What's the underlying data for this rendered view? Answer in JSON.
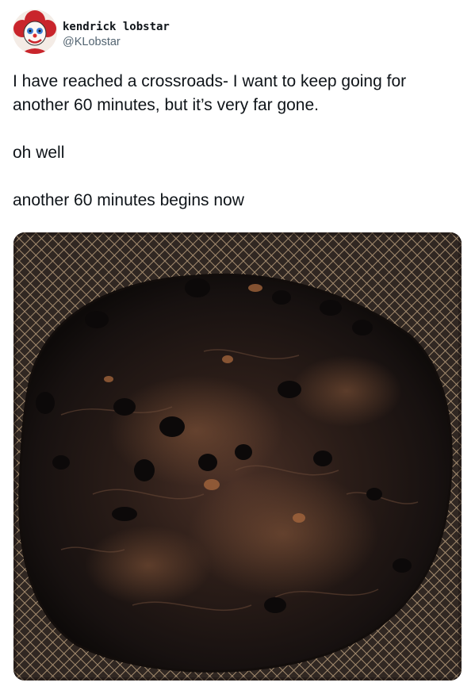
{
  "tweet": {
    "author": {
      "display_name": "kendrick lobstar",
      "handle": "@KLobstar",
      "avatar_icon": "clown-avatar-icon"
    },
    "text_lines": [
      "I have reached a crossroads- I want to keep going for another 60 minutes, but it’s very far gone.",
      "oh well",
      "another 60 minutes begins now"
    ],
    "media": {
      "kind": "photo",
      "subject": "burnt-food-in-air-fryer-basket"
    }
  },
  "colors": {
    "text_primary": "#0f1419",
    "text_secondary": "#536471",
    "background": "#ffffff"
  }
}
